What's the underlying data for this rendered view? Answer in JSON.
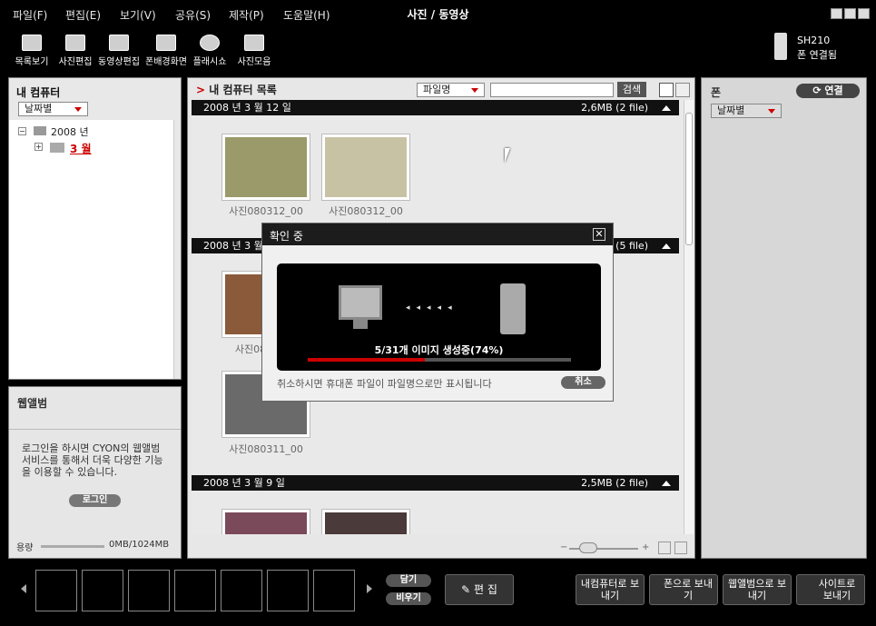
{
  "menu": {
    "items": [
      "파일(F)",
      "편집(E)",
      "보기(V)",
      "공유(S)",
      "제작(P)",
      "도움말(H)"
    ],
    "title": "사진 / 동영상"
  },
  "toolbar": {
    "items": [
      "목록보기",
      "사진편집",
      "동영상편집",
      "폰배경화면",
      "플래시쇼",
      "사진모음"
    ]
  },
  "phone_status": {
    "model": "SH210",
    "status": "폰 연결됨"
  },
  "left": {
    "title": "내 컴퓨터",
    "sort": "날짜별",
    "tree_year": "2008 년",
    "tree_month": "3 월"
  },
  "webalbum": {
    "title": "웹앨범",
    "text": "로그인을 하시면 CYON의 웹앨범 서비스를 통해서 더욱 다양한 기능을 이용할 수 있습니다.",
    "login": "로그인",
    "capacity_label": "용량",
    "capacity_value": "0MB/1024MB"
  },
  "center": {
    "title": "내 컴퓨터 목록",
    "search_field": "파일명",
    "search_btn": "검색",
    "search_value": ""
  },
  "groups": [
    {
      "date": "2008 년  3 월  12 일",
      "size": "2,6MB (2 file)"
    },
    {
      "date": "2008 년  3 월",
      "size": "(5 file)"
    },
    {
      "date": "2008 년  3 월  9 일",
      "size": "2,5MB (2 file)"
    }
  ],
  "captions": [
    "사진080312_00",
    "사진080312_00",
    "사진08",
    "사진080311_00"
  ],
  "right": {
    "title": "폰",
    "connect": "연결",
    "sort": "날짜별"
  },
  "dialog": {
    "title": "확인 중",
    "progress_text": "5/31개 이미지 생성중(74%)",
    "progress": 0.74,
    "note": "취소하시면 휴대폰 파일이 파일명으로만 표시됩니다",
    "cancel": "취소"
  },
  "bottom": {
    "pull": "담기",
    "empty": "비우기",
    "edit": "편 집",
    "send": [
      "내컴퓨터로 보내기",
      "폰으로 보내기",
      "웹앨범으로 보내기",
      "사이트로 보내기"
    ]
  },
  "zoom": {
    "min": "−",
    "plus": "+"
  },
  "colors": {
    "accent": "#cc0000"
  }
}
